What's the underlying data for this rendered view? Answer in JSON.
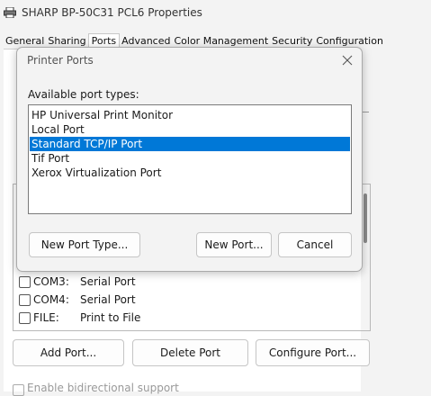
{
  "window": {
    "title": "SHARP BP-50C31 PCL6 Properties",
    "tabs": [
      "General",
      "Sharing",
      "Ports",
      "Advanced",
      "Color Management",
      "Security",
      "Configuration"
    ],
    "active_tab": "Ports"
  },
  "background": {
    "ports": [
      {
        "name": "COM3:",
        "description": "Serial Port",
        "checked": false
      },
      {
        "name": "COM4:",
        "description": "Serial Port",
        "checked": false
      },
      {
        "name": "FILE:",
        "description": "Print to File",
        "checked": false
      }
    ],
    "buttons": {
      "add_port": "Add Port...",
      "delete_port": "Delete Port",
      "configure_port": "Configure Port..."
    },
    "bidirectional": "Enable bidirectional support"
  },
  "dialog": {
    "title": "Printer Ports",
    "label": "Available port types:",
    "port_types": [
      "HP Universal Print Monitor",
      "Local Port",
      "Standard TCP/IP Port",
      "Tif Port",
      "Xerox Virtualization Port"
    ],
    "selected_index": 2,
    "buttons": {
      "new_port_type": "New Port Type...",
      "new_port": "New Port...",
      "cancel": "Cancel"
    }
  },
  "colors": {
    "selection": "#0078d7",
    "window_bg": "#f3f3f3"
  }
}
